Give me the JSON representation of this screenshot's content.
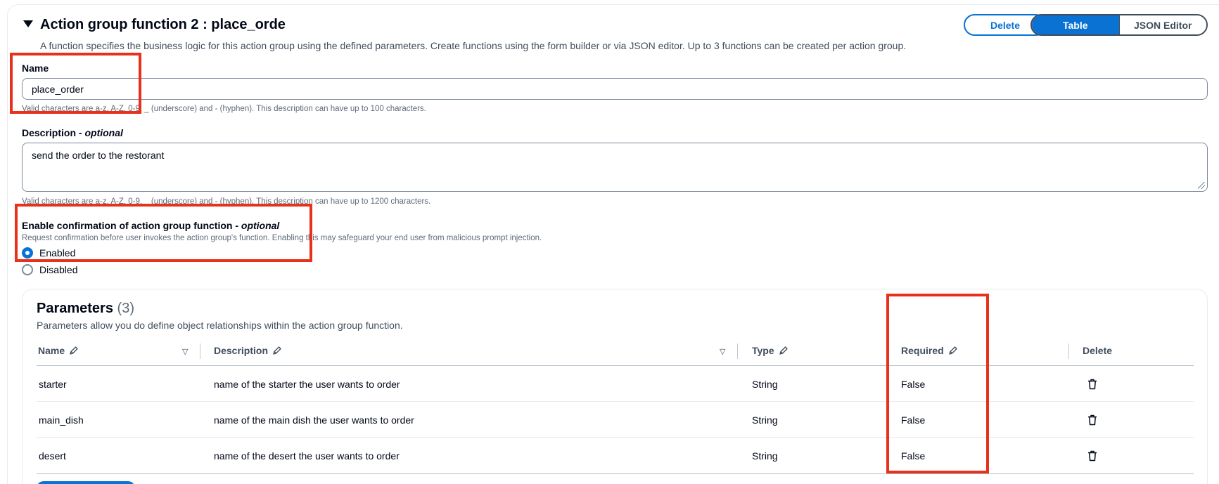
{
  "header": {
    "title": "Action group function 2 : place_orde",
    "description": "A function specifies the business logic for this action group using the defined parameters. Create functions using the form builder or via JSON editor. Up to 3 functions can be created per action group.",
    "delete_label": "Delete",
    "view_modes": [
      "Table",
      "JSON Editor"
    ],
    "active_view": "Table"
  },
  "name_field": {
    "label": "Name",
    "value": "place_order",
    "hint": "Valid characters are a-z, A-Z, 0-9, _ (underscore) and - (hyphen). This description can have up to 100 characters."
  },
  "description_field": {
    "label": "Description - ",
    "label_suffix": "optional",
    "value": "send the order to the restorant",
    "hint": "Valid characters are a-z, A-Z, 0-9, _ (underscore) and - (hyphen). This description can have up to 1200 characters."
  },
  "confirmation": {
    "label": "Enable confirmation of action group function - ",
    "label_suffix": "optional",
    "hint": "Request confirmation before user invokes the action group's function. Enabling this may safeguard your end user from malicious prompt injection.",
    "options": [
      "Enabled",
      "Disabled"
    ],
    "selected": "Enabled"
  },
  "parameters": {
    "title": "Parameters",
    "count": "(3)",
    "description": "Parameters allow you do define object relationships within the action group function.",
    "columns": [
      "Name",
      "Description",
      "Type",
      "Required",
      "Delete"
    ],
    "rows": [
      {
        "name": "starter",
        "description": "name of the starter the user wants to order",
        "type": "String",
        "required": "False"
      },
      {
        "name": "main_dish",
        "description": "name of the main dish the user wants to order",
        "type": "String",
        "required": "False"
      },
      {
        "name": "desert",
        "description": "name of the desert the user wants to order",
        "type": "String",
        "required": "False"
      }
    ]
  },
  "colors": {
    "accent": "#0972d3",
    "highlight": "#e8311a"
  },
  "icons": {
    "caret": "caret-down-icon",
    "edit": "pencil-icon",
    "sort": "sort-down-icon",
    "delete": "trash-icon"
  }
}
